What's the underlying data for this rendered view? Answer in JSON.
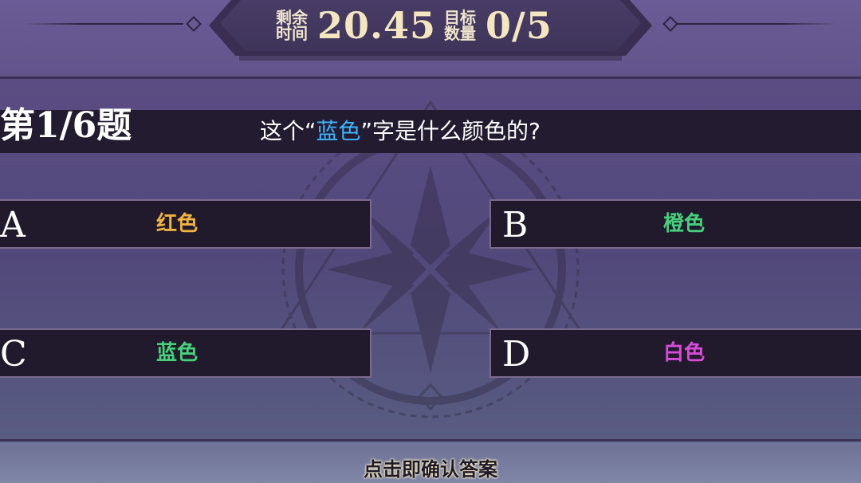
{
  "hud": {
    "time_label_line1": "剩余",
    "time_label_line2": "时间",
    "time_value": "20.45",
    "target_label_line1": "目标",
    "target_label_line2": "数量",
    "target_value": "0/5"
  },
  "question": {
    "number": "第1/6题",
    "text_before": "这个“",
    "text_highlight": "蓝色",
    "text_after": "”字是什么颜色的?",
    "highlight_color": "#3fb5ff"
  },
  "options": [
    {
      "letter": "A",
      "text": "红色",
      "color": "#f0b43c"
    },
    {
      "letter": "B",
      "text": "橙色",
      "color": "#46d07a"
    },
    {
      "letter": "C",
      "text": "蓝色",
      "color": "#46d07a"
    },
    {
      "letter": "D",
      "text": "白色",
      "color": "#d84ad8"
    }
  ],
  "footer": {
    "hint": "点击即确认答案"
  }
}
